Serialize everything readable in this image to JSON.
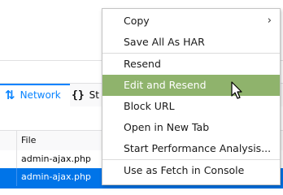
{
  "devtools": {
    "tabs": [
      {
        "label": "Network",
        "icon": "network-arrows-icon"
      },
      {
        "label": "St",
        "icon": "braces-icon"
      }
    ],
    "table": {
      "column_header": "File",
      "rows": [
        "admin-ajax.php",
        "admin-ajax.php"
      ]
    }
  },
  "context_menu": {
    "items": [
      {
        "label": "Copy",
        "submenu": true
      },
      {
        "label": "Save All As HAR"
      },
      {
        "label": "Resend"
      },
      {
        "label": "Edit and Resend",
        "highlighted": true
      },
      {
        "label": "Block URL"
      },
      {
        "label": "Open in New Tab"
      },
      {
        "label": "Start Performance Analysis..."
      },
      {
        "label": "Use as Fetch in Console"
      }
    ]
  },
  "colors": {
    "accent_blue": "#0a84ff",
    "selected_row": "#0074e8",
    "menu_highlight": "#8fb36c"
  }
}
